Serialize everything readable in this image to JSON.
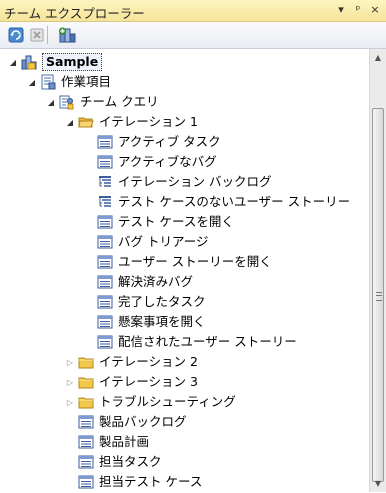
{
  "window": {
    "title": "チーム エクスプローラー",
    "buttons": [
      "▾",
      "ᵖ",
      "×"
    ]
  },
  "toolbar": {
    "items": [
      {
        "name": "refresh-button",
        "icon": "refresh-icon"
      },
      {
        "name": "stop-button",
        "icon": "stop-icon"
      },
      {
        "name": "add-existing-project-button",
        "icon": "add-project-icon"
      }
    ]
  },
  "tree": {
    "nodes": [
      {
        "label": "Sample",
        "level": 0,
        "expander": "expanded",
        "icon": "team-project-icon",
        "selected": true
      },
      {
        "label": "作業項目",
        "level": 1,
        "expander": "expanded",
        "icon": "work-items-icon"
      },
      {
        "label": "チーム クエリ",
        "level": 2,
        "expander": "expanded",
        "icon": "team-queries-icon"
      },
      {
        "label": "イテレーション 1",
        "level": 3,
        "expander": "expanded",
        "icon": "open-folder-icon"
      },
      {
        "label": "アクティブ タスク",
        "level": 4,
        "expander": "none",
        "icon": "flat-query-icon"
      },
      {
        "label": "アクティブなバグ",
        "level": 4,
        "expander": "none",
        "icon": "flat-query-icon"
      },
      {
        "label": "イテレーション バックログ",
        "level": 4,
        "expander": "none",
        "icon": "tree-query-icon"
      },
      {
        "label": "テスト ケースのないユーザー ストーリー",
        "level": 4,
        "expander": "none",
        "icon": "tree-query-icon"
      },
      {
        "label": "テスト ケースを開く",
        "level": 4,
        "expander": "none",
        "icon": "flat-query-icon"
      },
      {
        "label": "バグ トリアージ",
        "level": 4,
        "expander": "none",
        "icon": "flat-query-icon"
      },
      {
        "label": "ユーザー ストーリーを開く",
        "level": 4,
        "expander": "none",
        "icon": "flat-query-icon"
      },
      {
        "label": "解決済みバグ",
        "level": 4,
        "expander": "none",
        "icon": "flat-query-icon"
      },
      {
        "label": "完了したタスク",
        "level": 4,
        "expander": "none",
        "icon": "flat-query-icon"
      },
      {
        "label": "懸案事項を開く",
        "level": 4,
        "expander": "none",
        "icon": "flat-query-icon"
      },
      {
        "label": "配信されたユーザー ストーリー",
        "level": 4,
        "expander": "none",
        "icon": "flat-query-icon"
      },
      {
        "label": "イテレーション 2",
        "level": 3,
        "expander": "collapsed",
        "icon": "folder-icon"
      },
      {
        "label": "イテレーション 3",
        "level": 3,
        "expander": "collapsed",
        "icon": "folder-icon"
      },
      {
        "label": "トラブルシューティング",
        "level": 3,
        "expander": "collapsed",
        "icon": "folder-icon"
      },
      {
        "label": "製品バックログ",
        "level": 3,
        "expander": "none",
        "icon": "flat-query-icon"
      },
      {
        "label": "製品計画",
        "level": 3,
        "expander": "none",
        "icon": "flat-query-icon"
      },
      {
        "label": "担当タスク",
        "level": 3,
        "expander": "none",
        "icon": "flat-query-icon"
      },
      {
        "label": "担当テスト ケース",
        "level": 3,
        "expander": "none",
        "icon": "flat-query-icon"
      }
    ]
  },
  "colors": {
    "title_bar": "#f6e49a",
    "folder": "#f2c84b",
    "query_icon": "#3b5e9a",
    "selection": "#eef3fb"
  }
}
